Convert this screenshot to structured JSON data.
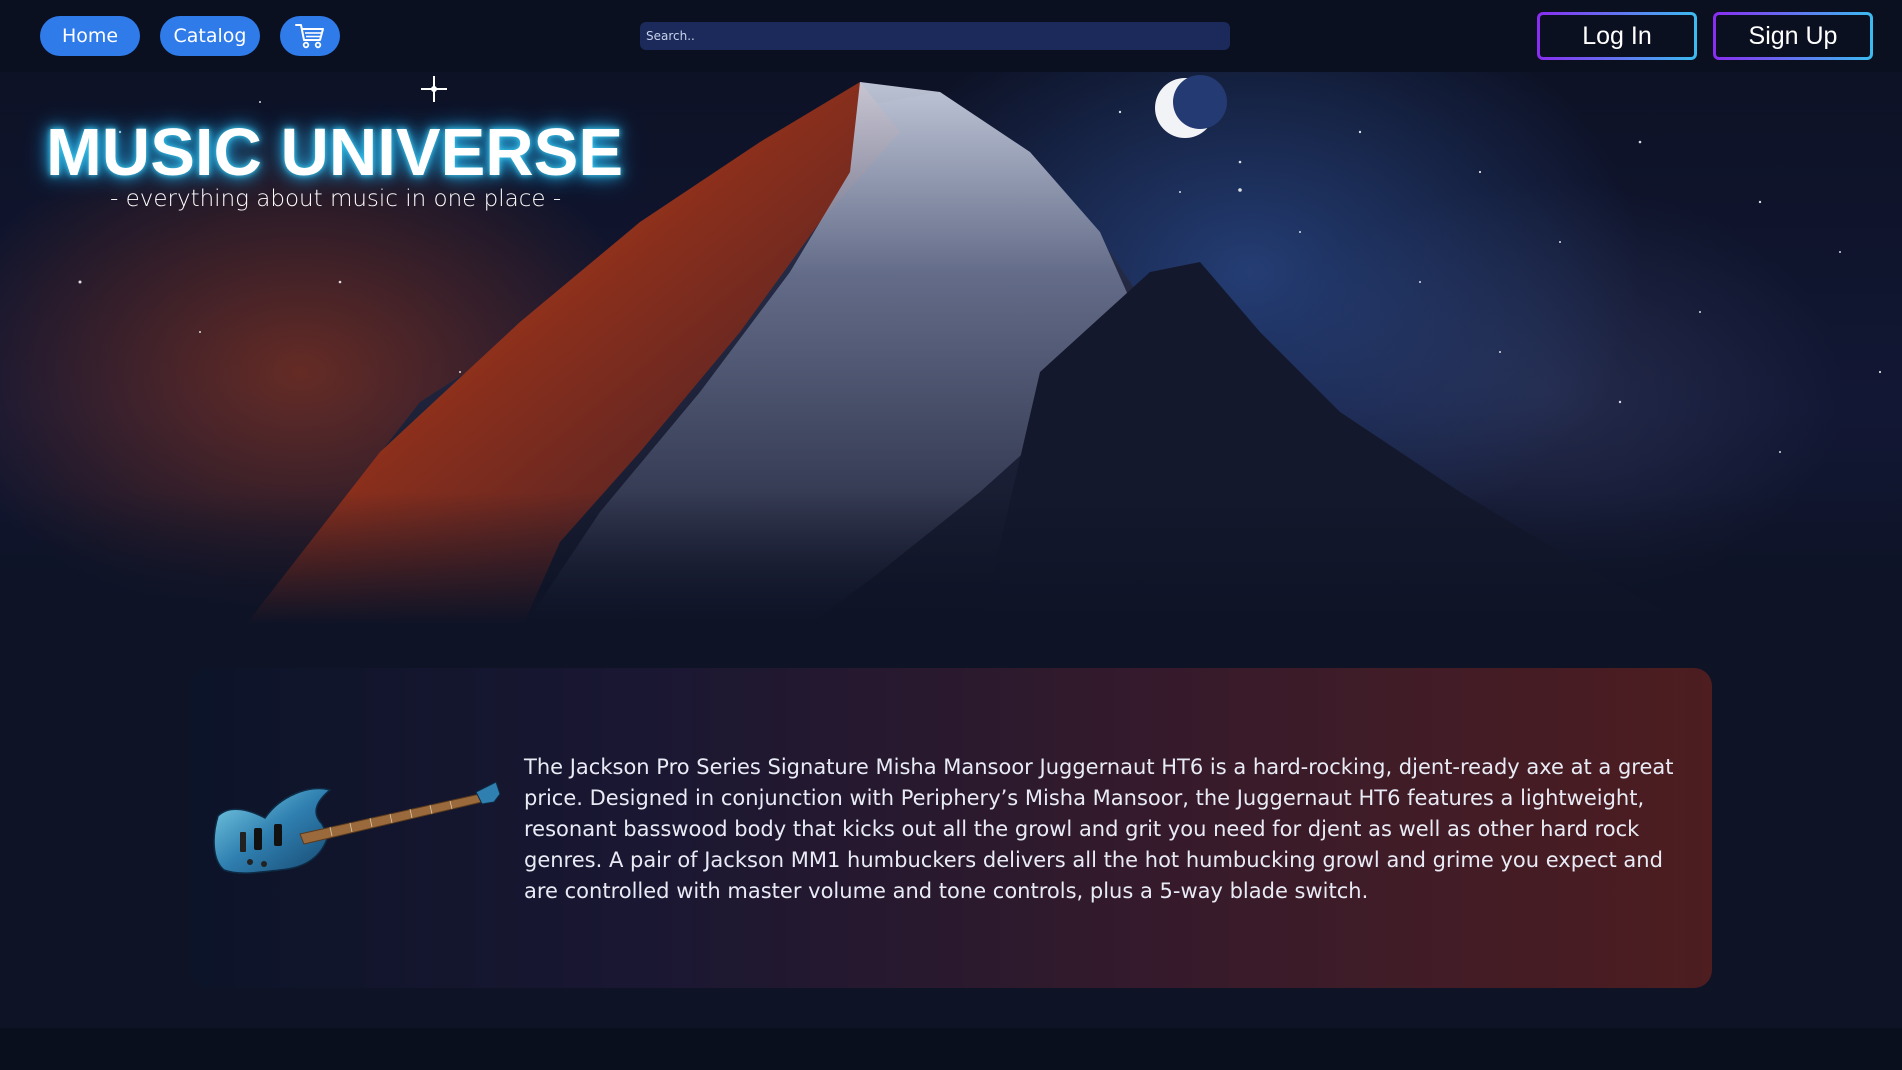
{
  "nav": {
    "home_label": "Home",
    "catalog_label": "Catalog",
    "cart_icon": "shopping-cart-icon",
    "search_placeholder": "Search..",
    "login_label": "Log In",
    "signup_label": "Sign Up"
  },
  "hero": {
    "title": "MUSIC UNIVERSE",
    "tagline": "- everything about music in one place -"
  },
  "product": {
    "image_icon": "electric-guitar-image",
    "description": "The Jackson Pro Series Signature Misha Mansoor Juggernaut HT6 is a hard-rocking, djent-ready axe at a great price. Designed in conjunction with Periphery’s Misha Mansoor, the Juggernaut HT6 features a lightweight, resonant basswood body that kicks out all the growl and grit you need for djent as well as other hard rock genres. A pair of Jackson MM1 humbuckers delivers all the hot humbucking growl and grime you expect and are controlled with master volume and tone controls, plus a 5-way blade switch."
  },
  "colors": {
    "nav_button": "#2f7bea",
    "search_bg": "#1b2a5a",
    "outline_gradient_start": "#8a2cf2",
    "outline_gradient_end": "#3bbcf0",
    "title_glow": "#3ed2f5",
    "page_bg": "#0e1326"
  }
}
